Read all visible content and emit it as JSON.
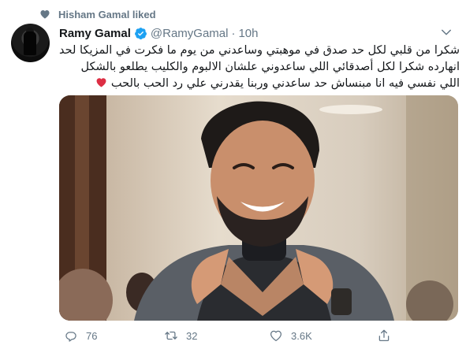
{
  "social_context": {
    "text": "Hisham Gamal liked"
  },
  "tweet": {
    "author_name": "Ramy Gamal",
    "handle": "@RamyGamal",
    "separator": "·",
    "time": "10h",
    "text_lines": [
      "شكرا من قلبي لكل حد صدق في موهبتي وساعدني من يوم ما فكرت في المزيكا لحد",
      "انهارده شكرا لكل أصدقائي اللي ساعدوني علشان الالبوم والكليب يطلعو بالشكل",
      "اللي نفسي فيه انا مبنساش حد ساعدني وربنا يقدرني علي رد الحب بالحب"
    ],
    "emoji": "red-heart"
  },
  "actions": {
    "reply_count": "76",
    "retweet_count": "32",
    "like_count": "3.6K"
  },
  "colors": {
    "secondary_text": "#657786",
    "verified_blue": "#1da1f2",
    "heart_red": "#e0245e"
  },
  "icons": [
    "heart-icon",
    "verified-icon",
    "chevron-down-icon",
    "reply-icon",
    "retweet-icon",
    "like-icon",
    "share-icon"
  ]
}
